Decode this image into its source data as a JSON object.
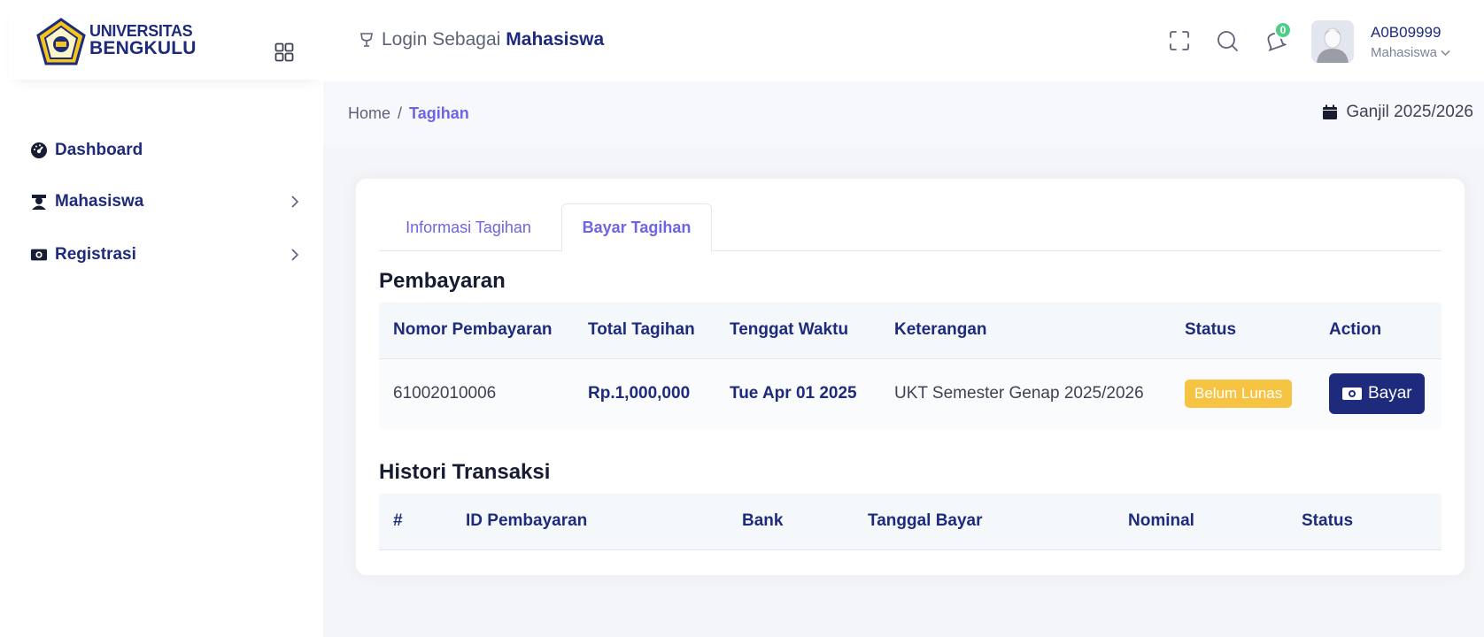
{
  "brand": {
    "line1": "UNIVERSITAS",
    "line2": "BENGKULU"
  },
  "sidebar": {
    "items": [
      {
        "label": "Dashboard",
        "icon": "dashboard-gauge-icon"
      },
      {
        "label": "Mahasiswa",
        "icon": "graduate-icon"
      },
      {
        "label": "Registrasi",
        "icon": "money-bill-icon"
      }
    ]
  },
  "header": {
    "login_prefix": "Login Sebagai",
    "login_role": "Mahasiswa",
    "notification_count": "0",
    "user_id": "A0B09999",
    "user_role": "Mahasiswa"
  },
  "breadcrumb": {
    "home": "Home",
    "separator": "/",
    "current": "Tagihan"
  },
  "semester": "Ganjil 2025/2026",
  "tabs": [
    {
      "label": "Informasi Tagihan"
    },
    {
      "label": "Bayar Tagihan",
      "active": true
    }
  ],
  "pembayaran": {
    "title": "Pembayaran",
    "columns": [
      "Nomor Pembayaran",
      "Total Tagihan",
      "Tenggat Waktu",
      "Keterangan",
      "Status",
      "Action"
    ],
    "rows": [
      {
        "nomor": "61002010006",
        "total": "Rp.1,000,000",
        "tenggat": "Tue Apr 01 2025",
        "keterangan": "UKT Semester Genap 2025/2026",
        "status": "Belum Lunas",
        "action": "Bayar"
      }
    ]
  },
  "histori": {
    "title": "Histori Transaksi",
    "columns": [
      "#",
      "ID Pembayaran",
      "Bank",
      "Tanggal Bayar",
      "Nominal",
      "Status"
    ]
  },
  "colors": {
    "primary": "#1e2b7d",
    "accent": "#6f63e6",
    "warning": "#f6c343",
    "success": "#50cd89"
  }
}
